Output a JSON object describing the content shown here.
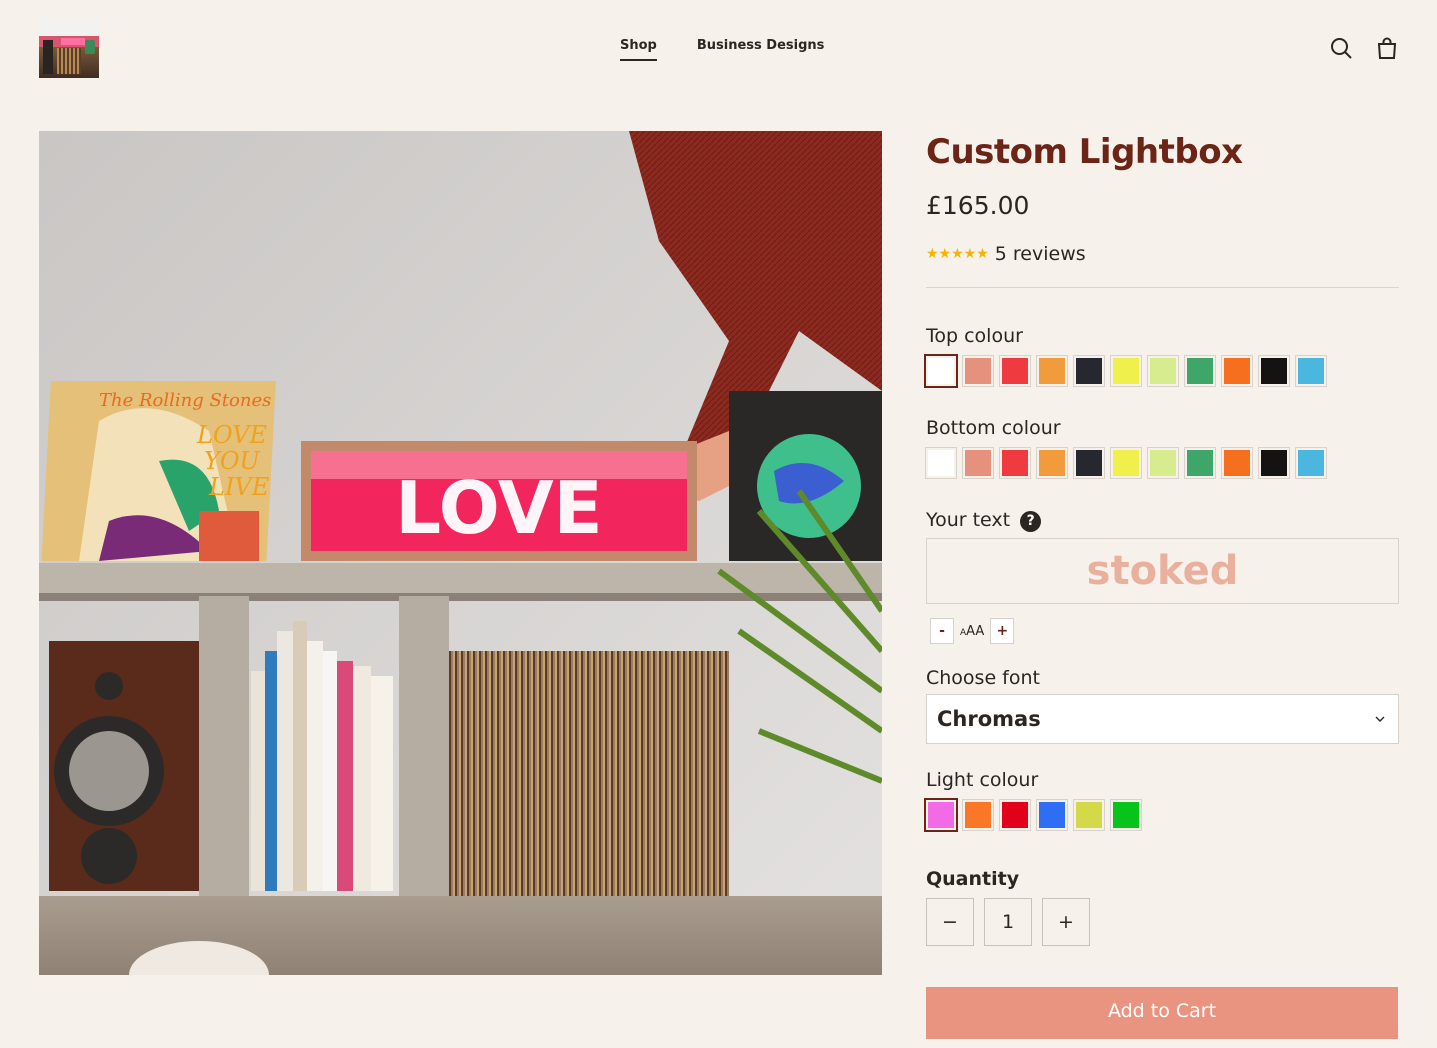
{
  "header": {
    "logo_icon": "store-logo-photo",
    "nav": [
      {
        "label": "Shop",
        "active": true
      },
      {
        "label": "Business Designs",
        "active": false
      }
    ],
    "icons": [
      "search-icon",
      "cart-icon"
    ]
  },
  "hero": {
    "sign_text": "LOVE",
    "record_title": "The Rolling Stones",
    "record_subtitle": "LOVE YOU LIVE"
  },
  "product": {
    "title": "Custom Lightbox",
    "price": "£165.00",
    "rating_stars": 5,
    "reviews": "5 reviews",
    "top_colour": {
      "label": "Top colour",
      "selected": 0,
      "colors": [
        "#ffffff",
        "#e6917e",
        "#ef3a3f",
        "#f29b3d",
        "#272730",
        "#f0f04d",
        "#d7eb8f",
        "#3fa66a",
        "#f56f1f",
        "#151212",
        "#4cb7de"
      ]
    },
    "bottom_colour": {
      "label": "Bottom colour",
      "selected": -1,
      "colors": [
        "#ffffff",
        "#e6917e",
        "#ef3a3f",
        "#f29b3d",
        "#272730",
        "#f0f04d",
        "#d7eb8f",
        "#3fa66a",
        "#f56f1f",
        "#151212",
        "#4cb7de"
      ]
    },
    "your_text": {
      "label": "Your text",
      "help_icon": "?",
      "value": "stoked",
      "size_minus": "-",
      "size_label_small": "A",
      "size_label_big": "AA",
      "size_plus": "+"
    },
    "font": {
      "label": "Choose font",
      "value": "Chromas"
    },
    "light_colour": {
      "label": "Light colour",
      "selected": 0,
      "colors": [
        "#f26ae6",
        "#f97726",
        "#e2001a",
        "#2e6ef5",
        "#d4d94a",
        "#08c41a"
      ]
    },
    "quantity": {
      "label": "Quantity",
      "value": "1",
      "minus": "−",
      "plus": "+"
    },
    "add_to_cart": "Add to Cart"
  },
  "colors": {
    "background": "#f6f1ea",
    "title": "#6b2416",
    "accent_button": "#e99480",
    "star": "#f4b400"
  }
}
